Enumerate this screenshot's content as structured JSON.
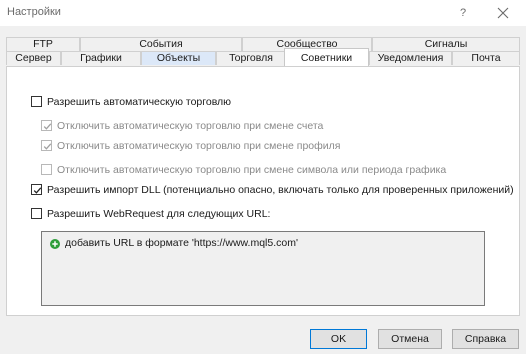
{
  "window": {
    "title": "Настройки",
    "help_label": "?"
  },
  "tabs": {
    "row1": [
      {
        "label": "FTP"
      },
      {
        "label": "События"
      },
      {
        "label": "Сообщество"
      },
      {
        "label": "Сигналы"
      }
    ],
    "row2": [
      {
        "label": "Сервер"
      },
      {
        "label": "Графики"
      },
      {
        "label": "Объекты"
      },
      {
        "label": "Торговля"
      },
      {
        "label": "Советники",
        "active": true
      },
      {
        "label": "Уведомления"
      },
      {
        "label": "Почта"
      }
    ]
  },
  "options": [
    {
      "label": "Разрешить автоматическую торговлю",
      "checked": false,
      "enabled": true
    },
    {
      "label": "Отключить автоматическую торговлю при смене счета",
      "checked": true,
      "enabled": false
    },
    {
      "label": "Отключить автоматическую торговлю при смене профиля",
      "checked": true,
      "enabled": false
    },
    {
      "label": "Отключить автоматическую торговлю при смене символа или периода графика",
      "checked": false,
      "enabled": false
    },
    {
      "label": "Разрешить импорт DLL (потенциально опасно, включать только для проверенных приложений)",
      "checked": true,
      "enabled": true
    },
    {
      "label": "Разрешить WebRequest для следующих URL:",
      "checked": false,
      "enabled": true
    }
  ],
  "url_list": {
    "add_label": "добавить URL в формате 'https://www.mql5.com'"
  },
  "buttons": {
    "ok": "OK",
    "cancel": "Отмена",
    "help": "Справка"
  },
  "colors": {
    "selected_tab_tint": "#dce8f8",
    "add_icon": "#2e9e3a",
    "ok_border": "#0078d7"
  }
}
